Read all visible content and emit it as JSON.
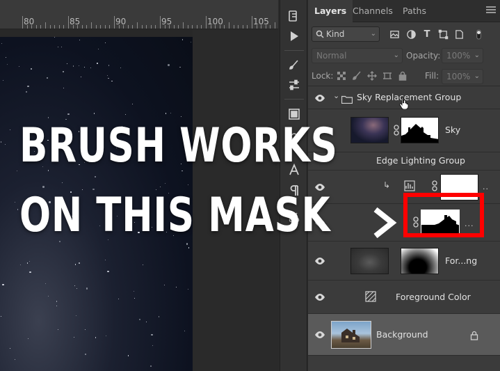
{
  "ruler": {
    "ticks": [
      "80",
      "85",
      "90",
      "95",
      "100",
      "105"
    ]
  },
  "tabs": [
    {
      "label": "Layers",
      "active": true
    },
    {
      "label": "Channels",
      "active": false
    },
    {
      "label": "Paths",
      "active": false
    }
  ],
  "filter": {
    "kind_label": "Kind"
  },
  "blend": {
    "mode": "Normal",
    "opacity_label": "Opacity:",
    "opacity_value": "100%"
  },
  "lock": {
    "label": "Lock:",
    "fill_label": "Fill:",
    "fill_value": "100%"
  },
  "layers": [
    {
      "name": "Sky Replacement Group",
      "type": "group"
    },
    {
      "name": "Sky",
      "type": "image-with-mask"
    },
    {
      "name": "Edge Lighting Group",
      "type": "group"
    },
    {
      "name": "",
      "type": "adjustment-clipped"
    },
    {
      "name": "",
      "type": "mask-highlighted"
    },
    {
      "name": "For...ng",
      "type": "image-with-mask"
    },
    {
      "name": "Foreground Color",
      "type": "adjustment"
    },
    {
      "name": "Background",
      "type": "background",
      "selected": true
    }
  ],
  "overlay": {
    "line1": "BRUSH WORKS",
    "line2": "ON THIS MASK"
  },
  "colors": {
    "highlight": "#ff0000",
    "panel": "#3b3b3b",
    "selected_row": "#5a5a5a"
  },
  "icons": [
    "eye-icon",
    "folder-icon",
    "link-icon",
    "lock-icon",
    "search-icon",
    "chevron-down-icon",
    "panel-menu-icon"
  ]
}
